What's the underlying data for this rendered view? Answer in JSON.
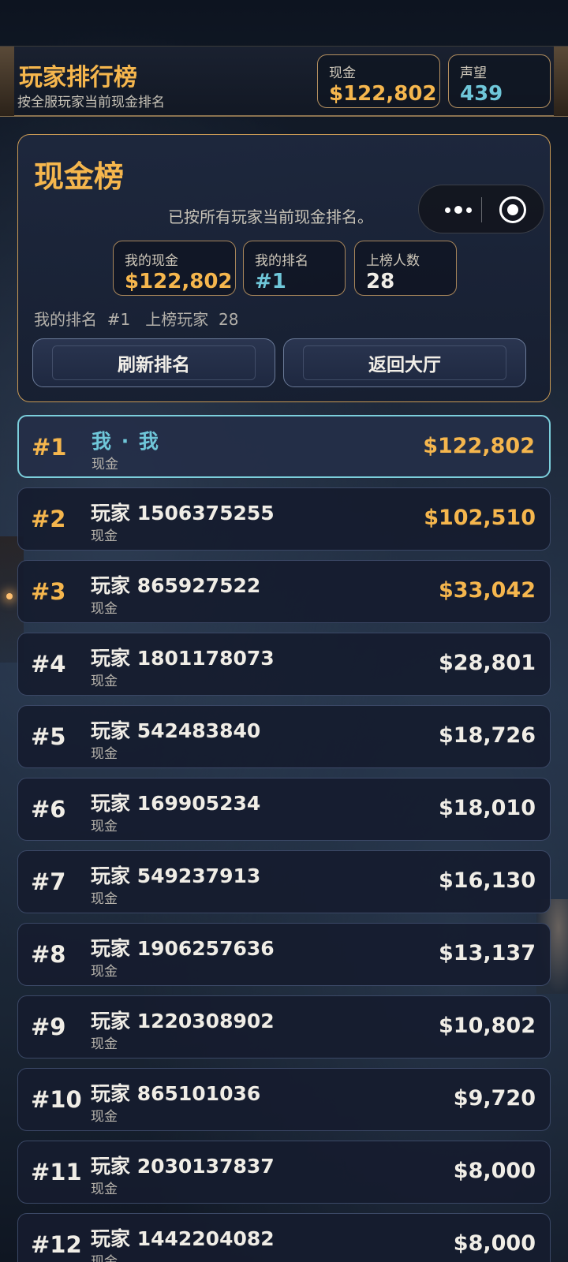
{
  "header": {
    "title": "玩家排行榜",
    "subtitle": "按全服玩家当前现金排名",
    "cash_label": "现金",
    "cash_value": "$122,802",
    "reputation_label": "声望",
    "reputation_value": "439"
  },
  "summary": {
    "title": "现金榜",
    "description": "已按所有玩家当前现金排名。",
    "my_cash_label": "我的现金",
    "my_cash_value": "$122,802",
    "my_rank_label": "我的排名",
    "my_rank_value": "#1",
    "count_label": "上榜人数",
    "count_value": "28",
    "info_line": "我的排名  #1   上榜玩家  28",
    "refresh_button": "刷新排名",
    "back_button": "返回大厅"
  },
  "leaderboard": [
    {
      "rank": "#1",
      "name": "我 · 我",
      "sub": "现金",
      "amount": "$122,802"
    },
    {
      "rank": "#2",
      "name": "玩家 1506375255",
      "sub": "现金",
      "amount": "$102,510"
    },
    {
      "rank": "#3",
      "name": "玩家 865927522",
      "sub": "现金",
      "amount": "$33,042"
    },
    {
      "rank": "#4",
      "name": "玩家 1801178073",
      "sub": "现金",
      "amount": "$28,801"
    },
    {
      "rank": "#5",
      "name": "玩家 542483840",
      "sub": "现金",
      "amount": "$18,726"
    },
    {
      "rank": "#6",
      "name": "玩家 169905234",
      "sub": "现金",
      "amount": "$18,010"
    },
    {
      "rank": "#7",
      "name": "玩家 549237913",
      "sub": "现金",
      "amount": "$16,130"
    },
    {
      "rank": "#8",
      "name": "玩家 1906257636",
      "sub": "现金",
      "amount": "$13,137"
    },
    {
      "rank": "#9",
      "name": "玩家 1220308902",
      "sub": "现金",
      "amount": "$10,802"
    },
    {
      "rank": "#10",
      "name": "玩家 865101036",
      "sub": "现金",
      "amount": "$9,720"
    },
    {
      "rank": "#11",
      "name": "玩家 2030137837",
      "sub": "现金",
      "amount": "$8,000"
    },
    {
      "rank": "#12",
      "name": "玩家 1442204082",
      "sub": "现金",
      "amount": "$8,000"
    }
  ],
  "capsule": {
    "more_icon": "more-dots-icon",
    "close_icon": "close-circle-icon"
  },
  "colors": {
    "accent_gold": "#f5b64d",
    "accent_cyan": "#6fc7d9"
  }
}
